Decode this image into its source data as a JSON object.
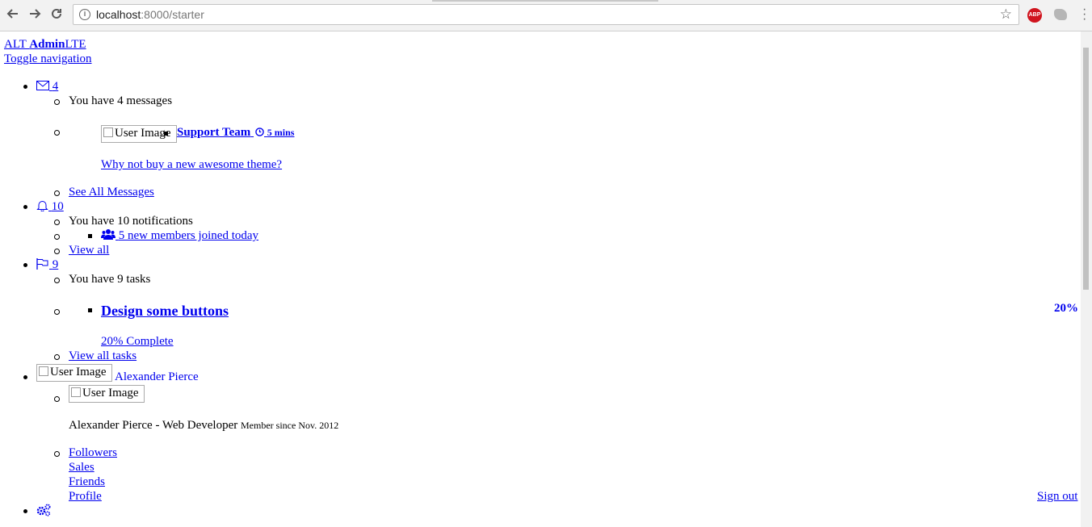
{
  "browser": {
    "url_host": "localhost",
    "url_path": ":8000/starter",
    "ext_abp_label": "ABP"
  },
  "brand": {
    "logo_prefix": "ALT ",
    "logo_bold": "Admin",
    "logo_suffix": "LTE"
  },
  "sidebar_toggle": "Toggle navigation",
  "messages": {
    "count": "4",
    "header": "You have 4 messages",
    "item": {
      "img_alt": "User Image",
      "sender": "Support Team",
      "time": "5 mins",
      "text": "Why not buy a new awesome theme?"
    },
    "footer": "See All Messages"
  },
  "notifications": {
    "count": "10",
    "header": "You have 10 notifications",
    "item": "5 new members joined today",
    "footer": "View all"
  },
  "tasks": {
    "count": "9",
    "header": "You have 9 tasks",
    "item": {
      "title": "Design some buttons",
      "percent": "20%",
      "complete": "20% Complete"
    },
    "footer": "View all tasks"
  },
  "user": {
    "img_alt": "User Image",
    "name": "Alexander Pierce",
    "panel_img_alt": "User Image",
    "title": "Alexander Pierce - Web Developer",
    "since": "Member since Nov. 2012",
    "links": [
      "Followers",
      "Sales",
      "Friends"
    ],
    "profile": "Profile",
    "signout": "Sign out"
  },
  "icons": {
    "messages": "envelope-icon",
    "notifications": "bell-icon",
    "tasks": "flag-icon",
    "clock": "clock-icon",
    "users": "users-icon",
    "settings": "gears-icon"
  },
  "colors": {
    "link": "#0000ee",
    "abp": "#d0141e"
  }
}
